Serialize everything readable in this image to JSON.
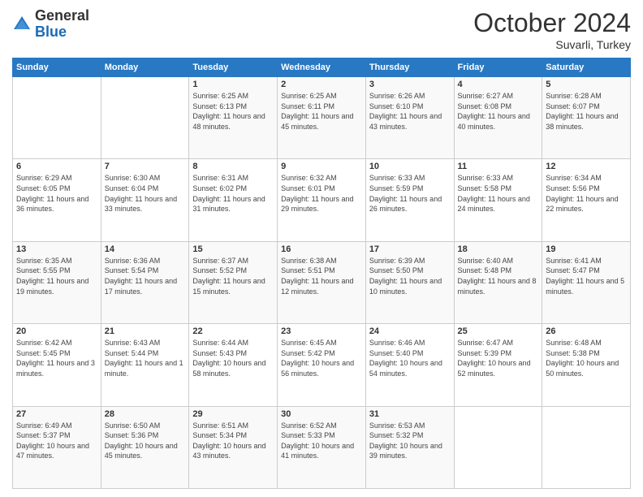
{
  "logo": {
    "general": "General",
    "blue": "Blue"
  },
  "header": {
    "month": "October 2024",
    "location": "Suvarli, Turkey"
  },
  "weekdays": [
    "Sunday",
    "Monday",
    "Tuesday",
    "Wednesday",
    "Thursday",
    "Friday",
    "Saturday"
  ],
  "weeks": [
    [
      null,
      null,
      {
        "day": 1,
        "sunrise": "Sunrise: 6:25 AM",
        "sunset": "Sunset: 6:13 PM",
        "daylight": "Daylight: 11 hours and 48 minutes."
      },
      {
        "day": 2,
        "sunrise": "Sunrise: 6:25 AM",
        "sunset": "Sunset: 6:11 PM",
        "daylight": "Daylight: 11 hours and 45 minutes."
      },
      {
        "day": 3,
        "sunrise": "Sunrise: 6:26 AM",
        "sunset": "Sunset: 6:10 PM",
        "daylight": "Daylight: 11 hours and 43 minutes."
      },
      {
        "day": 4,
        "sunrise": "Sunrise: 6:27 AM",
        "sunset": "Sunset: 6:08 PM",
        "daylight": "Daylight: 11 hours and 40 minutes."
      },
      {
        "day": 5,
        "sunrise": "Sunrise: 6:28 AM",
        "sunset": "Sunset: 6:07 PM",
        "daylight": "Daylight: 11 hours and 38 minutes."
      }
    ],
    [
      {
        "day": 6,
        "sunrise": "Sunrise: 6:29 AM",
        "sunset": "Sunset: 6:05 PM",
        "daylight": "Daylight: 11 hours and 36 minutes."
      },
      {
        "day": 7,
        "sunrise": "Sunrise: 6:30 AM",
        "sunset": "Sunset: 6:04 PM",
        "daylight": "Daylight: 11 hours and 33 minutes."
      },
      {
        "day": 8,
        "sunrise": "Sunrise: 6:31 AM",
        "sunset": "Sunset: 6:02 PM",
        "daylight": "Daylight: 11 hours and 31 minutes."
      },
      {
        "day": 9,
        "sunrise": "Sunrise: 6:32 AM",
        "sunset": "Sunset: 6:01 PM",
        "daylight": "Daylight: 11 hours and 29 minutes."
      },
      {
        "day": 10,
        "sunrise": "Sunrise: 6:33 AM",
        "sunset": "Sunset: 5:59 PM",
        "daylight": "Daylight: 11 hours and 26 minutes."
      },
      {
        "day": 11,
        "sunrise": "Sunrise: 6:33 AM",
        "sunset": "Sunset: 5:58 PM",
        "daylight": "Daylight: 11 hours and 24 minutes."
      },
      {
        "day": 12,
        "sunrise": "Sunrise: 6:34 AM",
        "sunset": "Sunset: 5:56 PM",
        "daylight": "Daylight: 11 hours and 22 minutes."
      }
    ],
    [
      {
        "day": 13,
        "sunrise": "Sunrise: 6:35 AM",
        "sunset": "Sunset: 5:55 PM",
        "daylight": "Daylight: 11 hours and 19 minutes."
      },
      {
        "day": 14,
        "sunrise": "Sunrise: 6:36 AM",
        "sunset": "Sunset: 5:54 PM",
        "daylight": "Daylight: 11 hours and 17 minutes."
      },
      {
        "day": 15,
        "sunrise": "Sunrise: 6:37 AM",
        "sunset": "Sunset: 5:52 PM",
        "daylight": "Daylight: 11 hours and 15 minutes."
      },
      {
        "day": 16,
        "sunrise": "Sunrise: 6:38 AM",
        "sunset": "Sunset: 5:51 PM",
        "daylight": "Daylight: 11 hours and 12 minutes."
      },
      {
        "day": 17,
        "sunrise": "Sunrise: 6:39 AM",
        "sunset": "Sunset: 5:50 PM",
        "daylight": "Daylight: 11 hours and 10 minutes."
      },
      {
        "day": 18,
        "sunrise": "Sunrise: 6:40 AM",
        "sunset": "Sunset: 5:48 PM",
        "daylight": "Daylight: 11 hours and 8 minutes."
      },
      {
        "day": 19,
        "sunrise": "Sunrise: 6:41 AM",
        "sunset": "Sunset: 5:47 PM",
        "daylight": "Daylight: 11 hours and 5 minutes."
      }
    ],
    [
      {
        "day": 20,
        "sunrise": "Sunrise: 6:42 AM",
        "sunset": "Sunset: 5:45 PM",
        "daylight": "Daylight: 11 hours and 3 minutes."
      },
      {
        "day": 21,
        "sunrise": "Sunrise: 6:43 AM",
        "sunset": "Sunset: 5:44 PM",
        "daylight": "Daylight: 11 hours and 1 minute."
      },
      {
        "day": 22,
        "sunrise": "Sunrise: 6:44 AM",
        "sunset": "Sunset: 5:43 PM",
        "daylight": "Daylight: 10 hours and 58 minutes."
      },
      {
        "day": 23,
        "sunrise": "Sunrise: 6:45 AM",
        "sunset": "Sunset: 5:42 PM",
        "daylight": "Daylight: 10 hours and 56 minutes."
      },
      {
        "day": 24,
        "sunrise": "Sunrise: 6:46 AM",
        "sunset": "Sunset: 5:40 PM",
        "daylight": "Daylight: 10 hours and 54 minutes."
      },
      {
        "day": 25,
        "sunrise": "Sunrise: 6:47 AM",
        "sunset": "Sunset: 5:39 PM",
        "daylight": "Daylight: 10 hours and 52 minutes."
      },
      {
        "day": 26,
        "sunrise": "Sunrise: 6:48 AM",
        "sunset": "Sunset: 5:38 PM",
        "daylight": "Daylight: 10 hours and 50 minutes."
      }
    ],
    [
      {
        "day": 27,
        "sunrise": "Sunrise: 6:49 AM",
        "sunset": "Sunset: 5:37 PM",
        "daylight": "Daylight: 10 hours and 47 minutes."
      },
      {
        "day": 28,
        "sunrise": "Sunrise: 6:50 AM",
        "sunset": "Sunset: 5:36 PM",
        "daylight": "Daylight: 10 hours and 45 minutes."
      },
      {
        "day": 29,
        "sunrise": "Sunrise: 6:51 AM",
        "sunset": "Sunset: 5:34 PM",
        "daylight": "Daylight: 10 hours and 43 minutes."
      },
      {
        "day": 30,
        "sunrise": "Sunrise: 6:52 AM",
        "sunset": "Sunset: 5:33 PM",
        "daylight": "Daylight: 10 hours and 41 minutes."
      },
      {
        "day": 31,
        "sunrise": "Sunrise: 6:53 AM",
        "sunset": "Sunset: 5:32 PM",
        "daylight": "Daylight: 10 hours and 39 minutes."
      },
      null,
      null
    ]
  ]
}
